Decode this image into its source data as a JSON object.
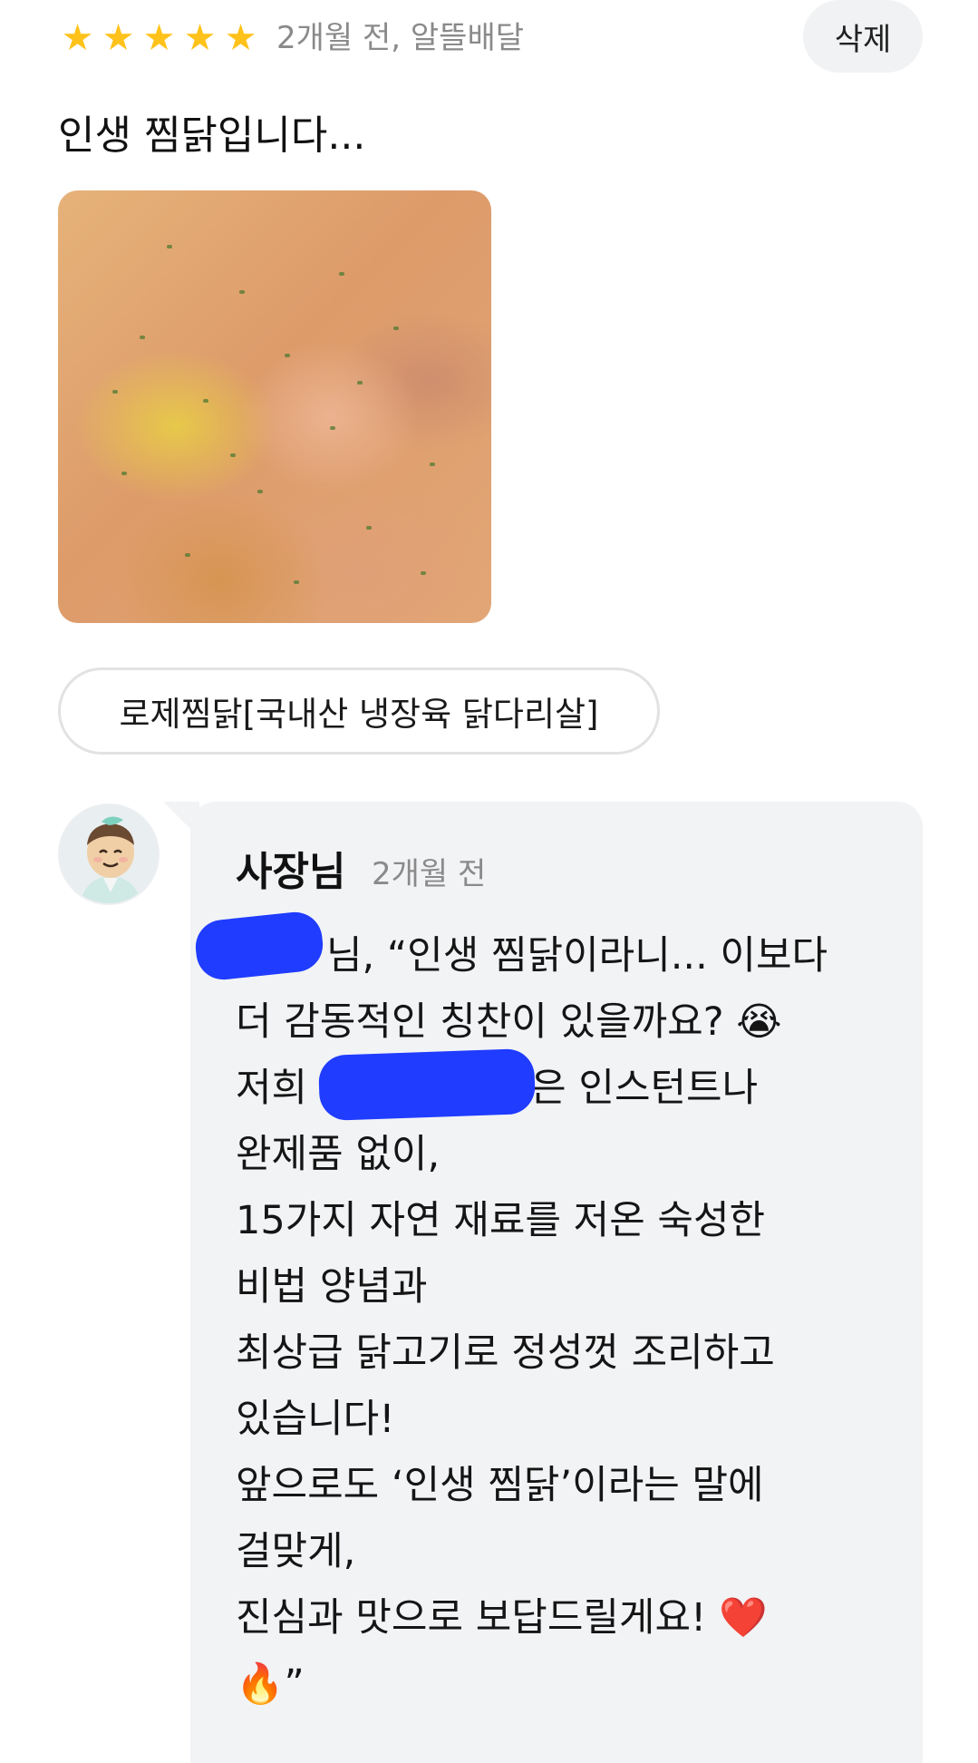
{
  "review": {
    "rating": 5,
    "rating_max": 5,
    "star_color": "#ffc21a",
    "meta": "2개월 전, 알뜰배달",
    "delete_label": "삭제",
    "text": "인생 찜닭입니다...",
    "menu_item": "로제찜닭[국내산 냉장육 닭다리살]"
  },
  "reply": {
    "author": "사장님",
    "time": "2개월 전",
    "lines": [
      "님, “인생 찜닭이라니... 이보다",
      "더 감동적인 칭찬이 있을까요? 😭",
      "저희                  은 인스턴트나",
      "완제품 없이,",
      "15가지 자연 재료를 저온 숙성한",
      "비법 양념과",
      "최상급 닭고기로 정성껏 조리하고",
      "있습니다!",
      "앞으로도 ‘인생 찜닭’이라는 말에",
      "걸맞게,",
      "진심과 맛으로 보답드릴게요! ❤️",
      "🔥”"
    ]
  }
}
